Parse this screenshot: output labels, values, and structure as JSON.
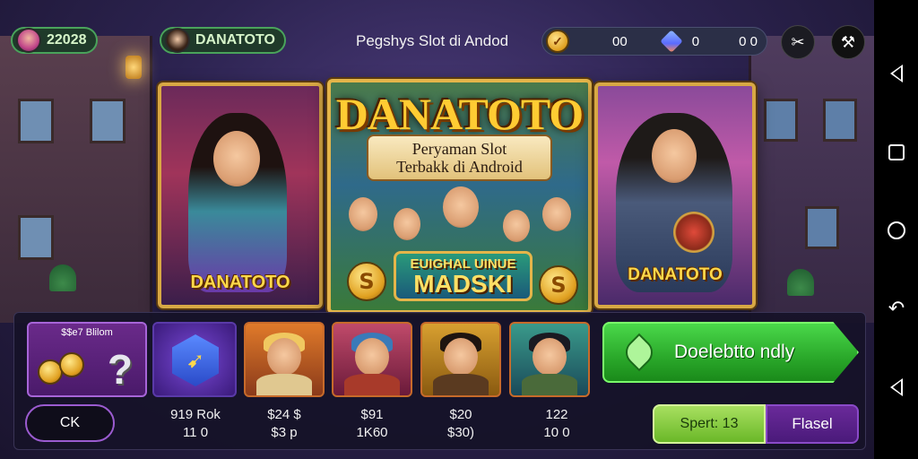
{
  "topbar": {
    "player_score": "22028",
    "player_name": "DANATOTO",
    "title": "Pegshys Slot di Andod",
    "wallet": {
      "coins": "00",
      "gems": "0",
      "extra": "0 0"
    }
  },
  "banners": {
    "left_label": "DANATOTO",
    "center_logo": "DANATOTO",
    "center_sub_line1": "Peryaman Slot",
    "center_sub_line2": "Terbakk di Android",
    "center_badge_line1": "EUIGHAL UINUE",
    "center_badge_line2": "MADSKI",
    "right_label": "DANATOTO"
  },
  "panel": {
    "bonus_label": "$$e7 Blilom",
    "ok_label": "CK",
    "games": [
      {
        "line1": "919 Rok",
        "line2": "11 0"
      },
      {
        "line1": "$24 $",
        "line2": "$3 p"
      },
      {
        "line1": "$91",
        "line2": "1K60"
      },
      {
        "line1": "$20",
        "line2": "$30)"
      },
      {
        "line1": "122",
        "line2": "10 0"
      }
    ],
    "cta_label": "Doelebtto ndly",
    "spin_label": "Spert: 13",
    "flasel_label": "Flasel"
  },
  "icons": {
    "coin": "coin-icon",
    "gem": "gem-icon",
    "scissors": "scissors-icon",
    "wrench": "wrench-icon",
    "nav_back": "back-triangle-icon",
    "nav_recents": "square-icon",
    "nav_home": "circle-icon",
    "nav_rotate": "rotate-icon"
  },
  "colors": {
    "accent_green": "#2aa82a",
    "accent_purple": "#6a2a9a",
    "gold": "#ffcc33"
  }
}
